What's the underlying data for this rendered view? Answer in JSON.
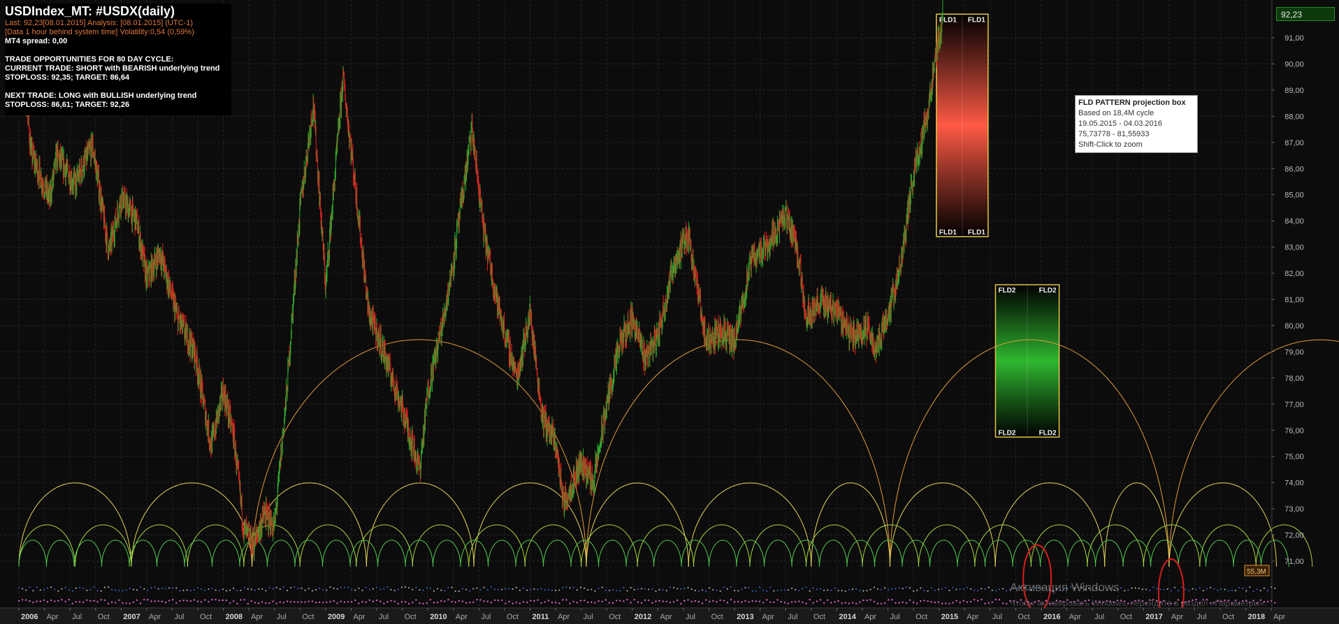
{
  "info": {
    "title": "USDIndex_MT: #USDX(daily)",
    "line1": "Last: 92,23[08.01.2015] Analysis: [08.01.2015] (UTC-1)",
    "line2": "[Data 1 hour behind system time] Volatility:0,54 (0,59%)",
    "line3": "MT4 spread: 0,00",
    "line4": "TRADE OPPORTUNITIES FOR 80 DAY CYCLE:",
    "line5": "CURRENT TRADE: SHORT with BEARISH underlying trend",
    "line6": "STOPLOSS: 92,35; TARGET: 86,64",
    "line7": "NEXT TRADE: LONG with BULLISH underlying trend",
    "line8": "STOPLOSS: 86,61; TARGET: 92,26"
  },
  "tooltip": {
    "title": "FLD PATTERN projection box",
    "line1": "Based on 18,4M cycle",
    "line2": "19.05.2015 - 04.03.2016",
    "line3": "75,73778 - 81,55933",
    "line4": "Shift-Click to zoom"
  },
  "price_badge": "92,23",
  "volume_badge": "55,3M",
  "watermark": "Активация Windows",
  "watermark_sub": "Чтобы активировать Windows, перейдите в раздел «Параметры».",
  "colors": {
    "background": "#0c0c0c",
    "bull_candle": "#2eaa2e",
    "bear_candle": "#e02020",
    "cycle_large": "#e39b3a",
    "cycle_mid": "#e6d65a",
    "cycle_small": "#a8d640",
    "cycle_tiny": "#4fc94f",
    "fld_box_border": "#e6c84a",
    "fld1_fill": "#ff5a45",
    "fld2_fill": "#2fb82f",
    "highlight": "#d81e1e"
  },
  "fld_boxes": [
    {
      "name": "FLD1",
      "label": "FLD1",
      "date_start": "2014-12-22",
      "date_end": "2015-06-24",
      "price_low": 83.4,
      "price_high": 91.9,
      "color": "red"
    },
    {
      "name": "FLD2",
      "label": "FLD2",
      "date_start": "2015-07-20",
      "date_end": "2016-03-04",
      "price_low": 75.74,
      "price_high": 81.56,
      "color": "green"
    }
  ],
  "chart_data": {
    "type": "candlestick",
    "title": "USDIndex_MT: #USDX(daily)",
    "ylim": [
      69.2,
      92.8
    ],
    "y_ticks": [
      "71,00",
      "72,00",
      "73,00",
      "74,00",
      "75,00",
      "76,00",
      "77,00",
      "78,00",
      "79,00",
      "80,00",
      "81,00",
      "82,00",
      "83,00",
      "84,00",
      "85,00",
      "86,00",
      "87,00",
      "88,00",
      "89,00",
      "90,00",
      "91,00"
    ],
    "y_tick_values": [
      71,
      72,
      73,
      74,
      75,
      76,
      77,
      78,
      79,
      80,
      81,
      82,
      83,
      84,
      85,
      86,
      87,
      88,
      89,
      90,
      91
    ],
    "x_labels": [
      "2006",
      "Apr",
      "Jul",
      "Oct",
      "2007",
      "Apr",
      "Jul",
      "Oct",
      "2008",
      "Apr",
      "Jul",
      "Oct",
      "2009",
      "Apr",
      "Jul",
      "Oct",
      "2010",
      "Apr",
      "Jul",
      "Oct",
      "2011",
      "Apr",
      "Jul",
      "Oct",
      "2012",
      "Apr",
      "Jul",
      "Oct",
      "2013",
      "Apr",
      "Jul",
      "Oct",
      "2014",
      "Apr",
      "Jul",
      "Oct",
      "2015",
      "Apr",
      "Jul",
      "Oct",
      "2016",
      "Apr",
      "Jul",
      "Oct",
      "2017",
      "Apr",
      "Jul",
      "Oct",
      "2018",
      "Apr"
    ],
    "x_start": 2005.93,
    "x_end": 2018.3,
    "price_path": [
      [
        2005.93,
        90.6
      ],
      [
        2006.05,
        89.5
      ],
      [
        2006.12,
        86.6
      ],
      [
        2006.3,
        84.8
      ],
      [
        2006.37,
        86.5
      ],
      [
        2006.55,
        85.4
      ],
      [
        2006.72,
        86.9
      ],
      [
        2006.88,
        82.8
      ],
      [
        2007.0,
        84.9
      ],
      [
        2007.15,
        84.0
      ],
      [
        2007.25,
        81.8
      ],
      [
        2007.38,
        82.8
      ],
      [
        2007.55,
        80.3
      ],
      [
        2007.72,
        79.0
      ],
      [
        2007.88,
        75.4
      ],
      [
        2008.0,
        77.5
      ],
      [
        2008.1,
        75.8
      ],
      [
        2008.2,
        72.2
      ],
      [
        2008.3,
        71.6
      ],
      [
        2008.4,
        72.8
      ],
      [
        2008.5,
        72.3
      ],
      [
        2008.62,
        77.5
      ],
      [
        2008.75,
        84.5
      ],
      [
        2008.88,
        88.5
      ],
      [
        2009.0,
        81.5
      ],
      [
        2009.17,
        89.5
      ],
      [
        2009.3,
        85.0
      ],
      [
        2009.42,
        80.5
      ],
      [
        2009.55,
        79.2
      ],
      [
        2009.75,
        76.8
      ],
      [
        2009.92,
        74.5
      ],
      [
        2010.0,
        77.5
      ],
      [
        2010.15,
        80.2
      ],
      [
        2010.25,
        82.5
      ],
      [
        2010.43,
        87.5
      ],
      [
        2010.55,
        83.5
      ],
      [
        2010.7,
        80.5
      ],
      [
        2010.87,
        78.0
      ],
      [
        2011.0,
        80.5
      ],
      [
        2011.12,
        76.5
      ],
      [
        2011.25,
        75.5
      ],
      [
        2011.33,
        73.2
      ],
      [
        2011.5,
        74.8
      ],
      [
        2011.62,
        74.0
      ],
      [
        2011.75,
        77.0
      ],
      [
        2011.88,
        79.3
      ],
      [
        2012.0,
        80.3
      ],
      [
        2012.12,
        78.8
      ],
      [
        2012.25,
        79.6
      ],
      [
        2012.4,
        82.3
      ],
      [
        2012.55,
        83.5
      ],
      [
        2012.72,
        79.4
      ],
      [
        2012.88,
        79.8
      ],
      [
        2013.0,
        79.3
      ],
      [
        2013.17,
        82.6
      ],
      [
        2013.3,
        83.0
      ],
      [
        2013.5,
        84.2
      ],
      [
        2013.6,
        83.2
      ],
      [
        2013.7,
        80.4
      ],
      [
        2013.85,
        80.9
      ],
      [
        2014.0,
        80.6
      ],
      [
        2014.15,
        79.6
      ],
      [
        2014.3,
        79.9
      ],
      [
        2014.38,
        79.1
      ],
      [
        2014.52,
        80.7
      ],
      [
        2014.62,
        82.2
      ],
      [
        2014.75,
        85.8
      ],
      [
        2014.88,
        88.0
      ],
      [
        2015.02,
        91.4
      ],
      [
        2015.04,
        92.23
      ]
    ],
    "cycle_bottoms": [
      "2006.0",
      "2008.28",
      "2010.45",
      "2011.35",
      "2012.55",
      "2013.75",
      "2014.52",
      "2016.02",
      "2017.25"
    ]
  },
  "volume_label": "55,3M"
}
